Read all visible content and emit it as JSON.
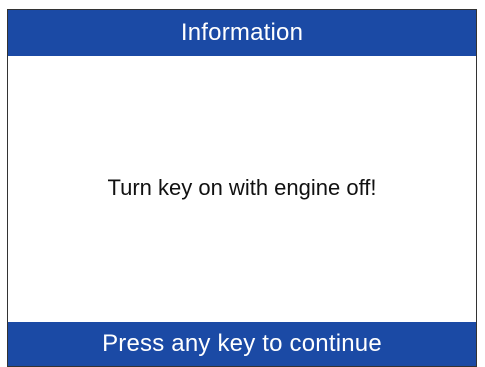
{
  "header": {
    "title": "Information"
  },
  "message": {
    "text": "Turn key on with engine off!"
  },
  "footer": {
    "prompt": "Press any key to continue"
  },
  "colors": {
    "bar_background": "#1b4aa5",
    "bar_text": "#ffffff",
    "body_background": "#ffffff",
    "body_text": "#111111"
  }
}
